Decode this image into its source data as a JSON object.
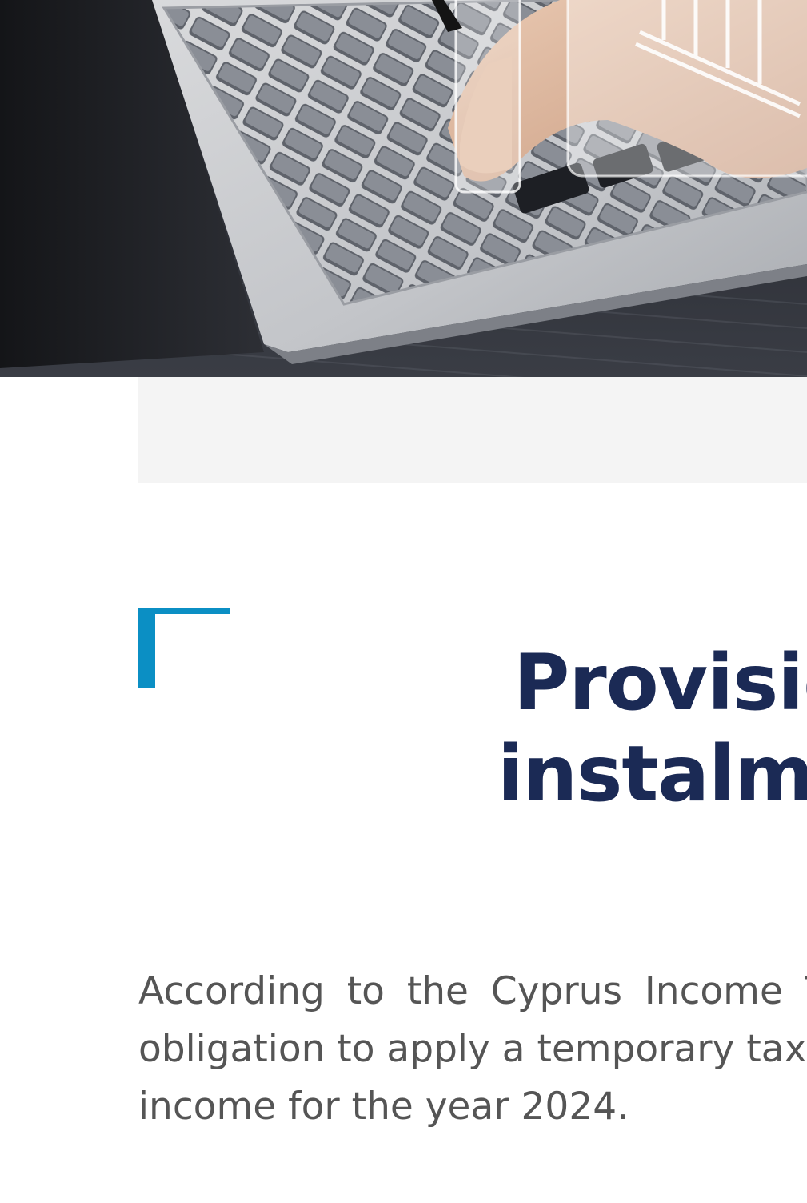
{
  "hero": {
    "image_icon": "laptop-keyboard-photo"
  },
  "title": {
    "line1": "Provisio",
    "line2": "instalm"
  },
  "body": {
    "line1": "According to the Cyprus Income Ta",
    "line2": "obligation to apply a temporary tax",
    "line3": "income for the year 2024."
  },
  "colors": {
    "accent": "#0b8fc4",
    "title": "#1b2a55",
    "body": "#555555",
    "band": "#f4f4f4"
  }
}
